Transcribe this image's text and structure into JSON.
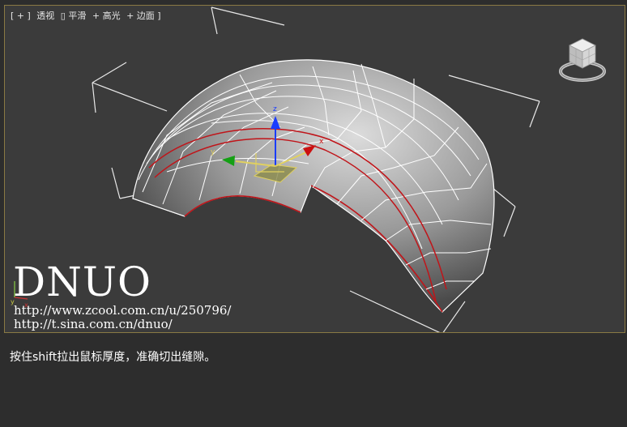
{
  "viewport": {
    "label_parts": [
      "[ + ]",
      "透视",
      "▯ 平滑",
      "+ 高光",
      "+ 边面 ]"
    ],
    "colors": {
      "frame": "#8a7a44",
      "background": "#3b3b3b",
      "selected_edge": "#c0151a",
      "wire": "#ffffff"
    },
    "gizmo": {
      "x_label": "x",
      "y_label": "y",
      "z_label": "z"
    },
    "corner_axis": {
      "x_label": "x",
      "y_label": "y"
    }
  },
  "watermark": {
    "title": "DNUO",
    "url1": "http://www.zcool.com.cn/u/250796/",
    "url2": "http://t.sina.com.cn/dnuo/"
  },
  "caption": "按住shift拉出鼠标厚度，准确切出缝隙。",
  "icons": [
    "viewcube-icon",
    "move-gizmo-icon",
    "axis-tripod-icon"
  ]
}
